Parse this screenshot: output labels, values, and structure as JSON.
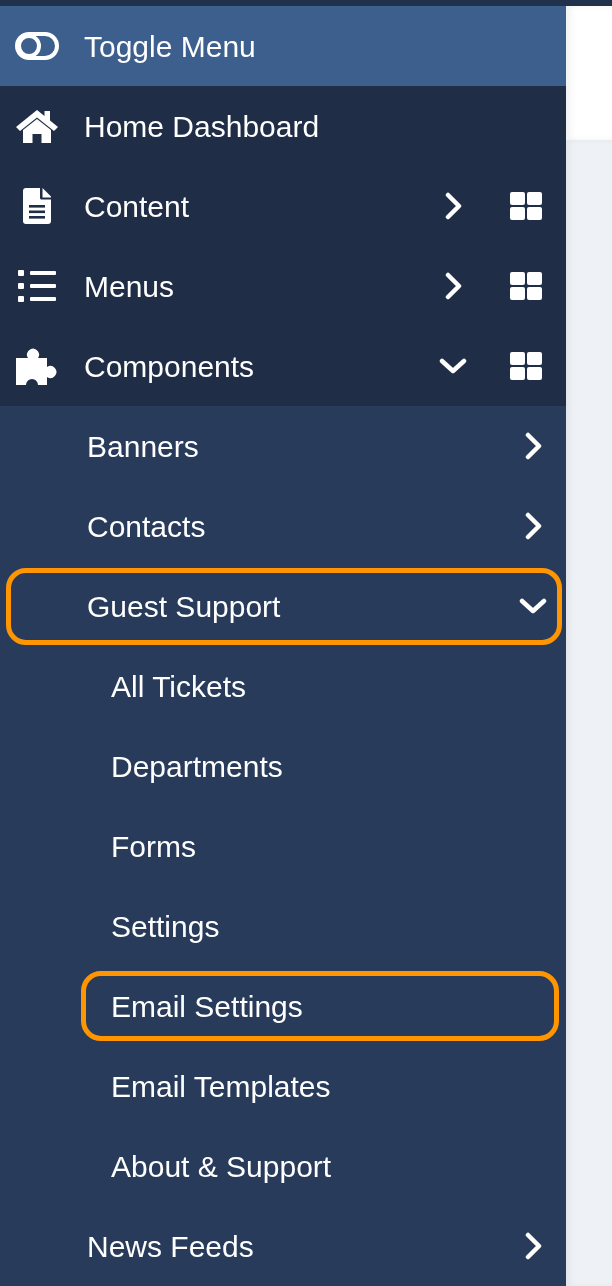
{
  "toggle_menu": {
    "label": "Toggle Menu"
  },
  "menu": [
    {
      "label": "Home Dashboard",
      "highlighted": false
    },
    {
      "label": "Content",
      "expanded": false,
      "highlighted": false
    },
    {
      "label": "Menus",
      "expanded": false,
      "highlighted": false
    },
    {
      "label": "Components",
      "expanded": true,
      "highlighted": false,
      "children": [
        {
          "label": "Banners",
          "expanded": false,
          "highlighted": false
        },
        {
          "label": "Contacts",
          "expanded": false,
          "highlighted": false
        },
        {
          "label": "Guest Support",
          "expanded": true,
          "highlighted": true,
          "children": [
            {
              "label": "All Tickets",
              "highlighted": false
            },
            {
              "label": "Departments",
              "highlighted": false
            },
            {
              "label": "Forms",
              "highlighted": false
            },
            {
              "label": "Settings",
              "highlighted": false
            },
            {
              "label": "Email Settings",
              "highlighted": true
            },
            {
              "label": "Email Templates",
              "highlighted": false
            },
            {
              "label": "About & Support",
              "highlighted": false
            }
          ]
        },
        {
          "label": "News Feeds",
          "expanded": false,
          "highlighted": false
        }
      ]
    }
  ]
}
